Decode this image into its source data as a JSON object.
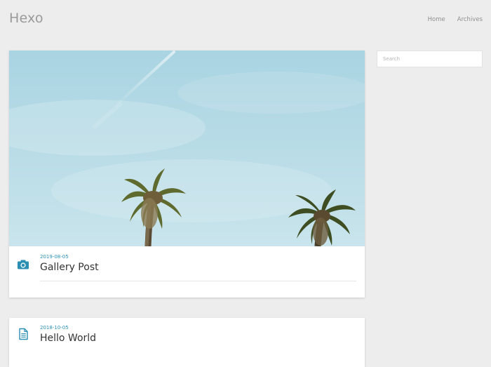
{
  "site": {
    "title": "Hexo"
  },
  "nav": {
    "items": [
      {
        "label": "Home"
      },
      {
        "label": "Archives"
      }
    ]
  },
  "sidebar": {
    "search": {
      "placeholder": "Search",
      "value": ""
    }
  },
  "posts": [
    {
      "date": "2019-08-05",
      "title": "Gallery Post",
      "icon": "camera-icon",
      "has_image": true
    },
    {
      "date": "2018-10-05",
      "title": "Hello World",
      "icon": "document-icon",
      "has_image": false
    }
  ],
  "colors": {
    "accent": "#2b8fb3",
    "background": "#eeedee",
    "card": "#ffffff"
  }
}
